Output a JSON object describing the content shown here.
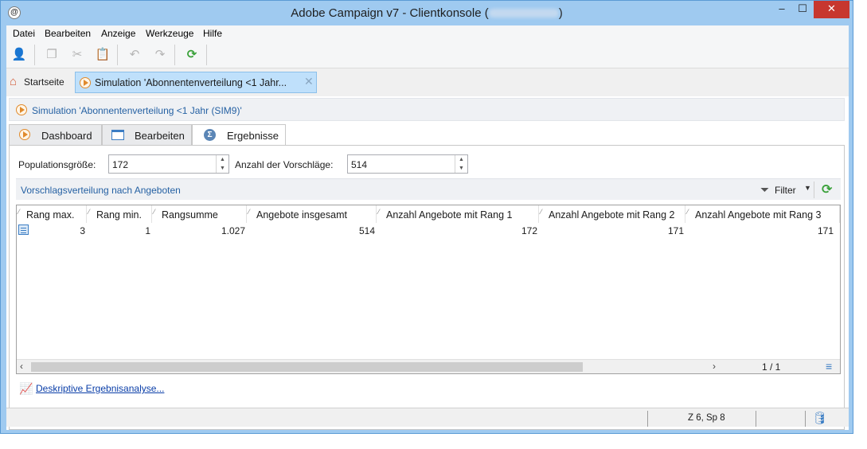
{
  "window": {
    "title": "Adobe Campaign v7 - Clientkonsole (",
    "title_end": ")",
    "app_icon_glyph": "@",
    "minimize_glyph": "–",
    "maximize_glyph": "☐",
    "close_glyph": "✕"
  },
  "menu": [
    "Datei",
    "Bearbeiten",
    "Anzeige",
    "Werkzeuge",
    "Hilfe"
  ],
  "toolbar": {
    "icons": [
      "new-user-icon",
      "copy-icon",
      "cut-icon",
      "paste-icon",
      "undo-icon",
      "redo-icon",
      "refresh-icon"
    ]
  },
  "doc_tabs": {
    "home": "Startseite",
    "simulation": "Simulation 'Abonnentenverteilung <1 Jahr...",
    "close_glyph": "✕"
  },
  "panel": {
    "header": "Simulation 'Abonnentenverteilung <1 Jahr  (SIM9)'"
  },
  "subtabs": [
    "Dashboard",
    "Bearbeiten",
    "Ergebnisse"
  ],
  "form": {
    "population_label": "Populationsgröße:",
    "population_value": "172",
    "proposals_label": "Anzahl der Vorschläge:",
    "proposals_value": "514"
  },
  "grid": {
    "title": "Vorschlagsverteilung nach Angeboten",
    "filter_label": "Filter",
    "columns": [
      "Rang max.",
      "Rang min.",
      "Rangsumme",
      "Angebote insgesamt",
      "Anzahl Angebote mit Rang 1",
      "Anzahl Angebote mit Rang 2",
      "Anzahl Angebote mit Rang 3"
    ],
    "rows": [
      [
        "3",
        "1",
        "1.027",
        "514",
        "172",
        "171",
        "171"
      ]
    ],
    "pager": "1 / 1"
  },
  "link": "Deskriptive Ergebnisanalyse...",
  "status": {
    "position": "Z 6, Sp 8"
  },
  "colors": {
    "accent_blue": "#2561a3",
    "window_frame": "#9fcaf0",
    "close_red": "#c7372f"
  }
}
